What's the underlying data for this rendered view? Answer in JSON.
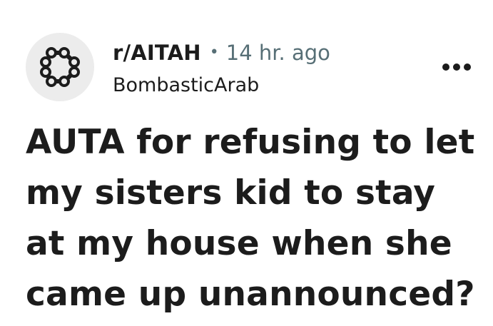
{
  "post": {
    "subreddit": "r/AITAH",
    "separator": "•",
    "time_ago": "14 hr. ago",
    "author": "BombasticArab",
    "title": "AUTA for refusing to let my sisters kid to stay at my house when she came up unannounced?"
  },
  "icons": {
    "avatar": "subreddit-community-icon",
    "more": "more-options-icon"
  },
  "colors": {
    "text_primary": "#1c1c1c",
    "text_secondary": "#576f76",
    "avatar_bg": "#ececec"
  }
}
